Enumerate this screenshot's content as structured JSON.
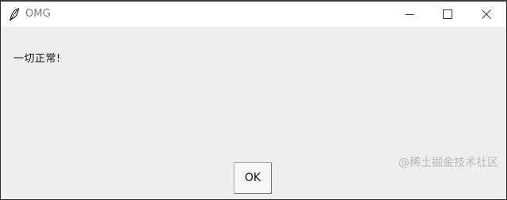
{
  "window": {
    "title": "OMG",
    "icon": "feather-icon",
    "controls": [
      "minimize-icon",
      "maximize-icon",
      "close-icon"
    ]
  },
  "dialog": {
    "message": "一切正常!",
    "ok_label": "OK"
  },
  "watermark": "@稀土掘金技术社区"
}
